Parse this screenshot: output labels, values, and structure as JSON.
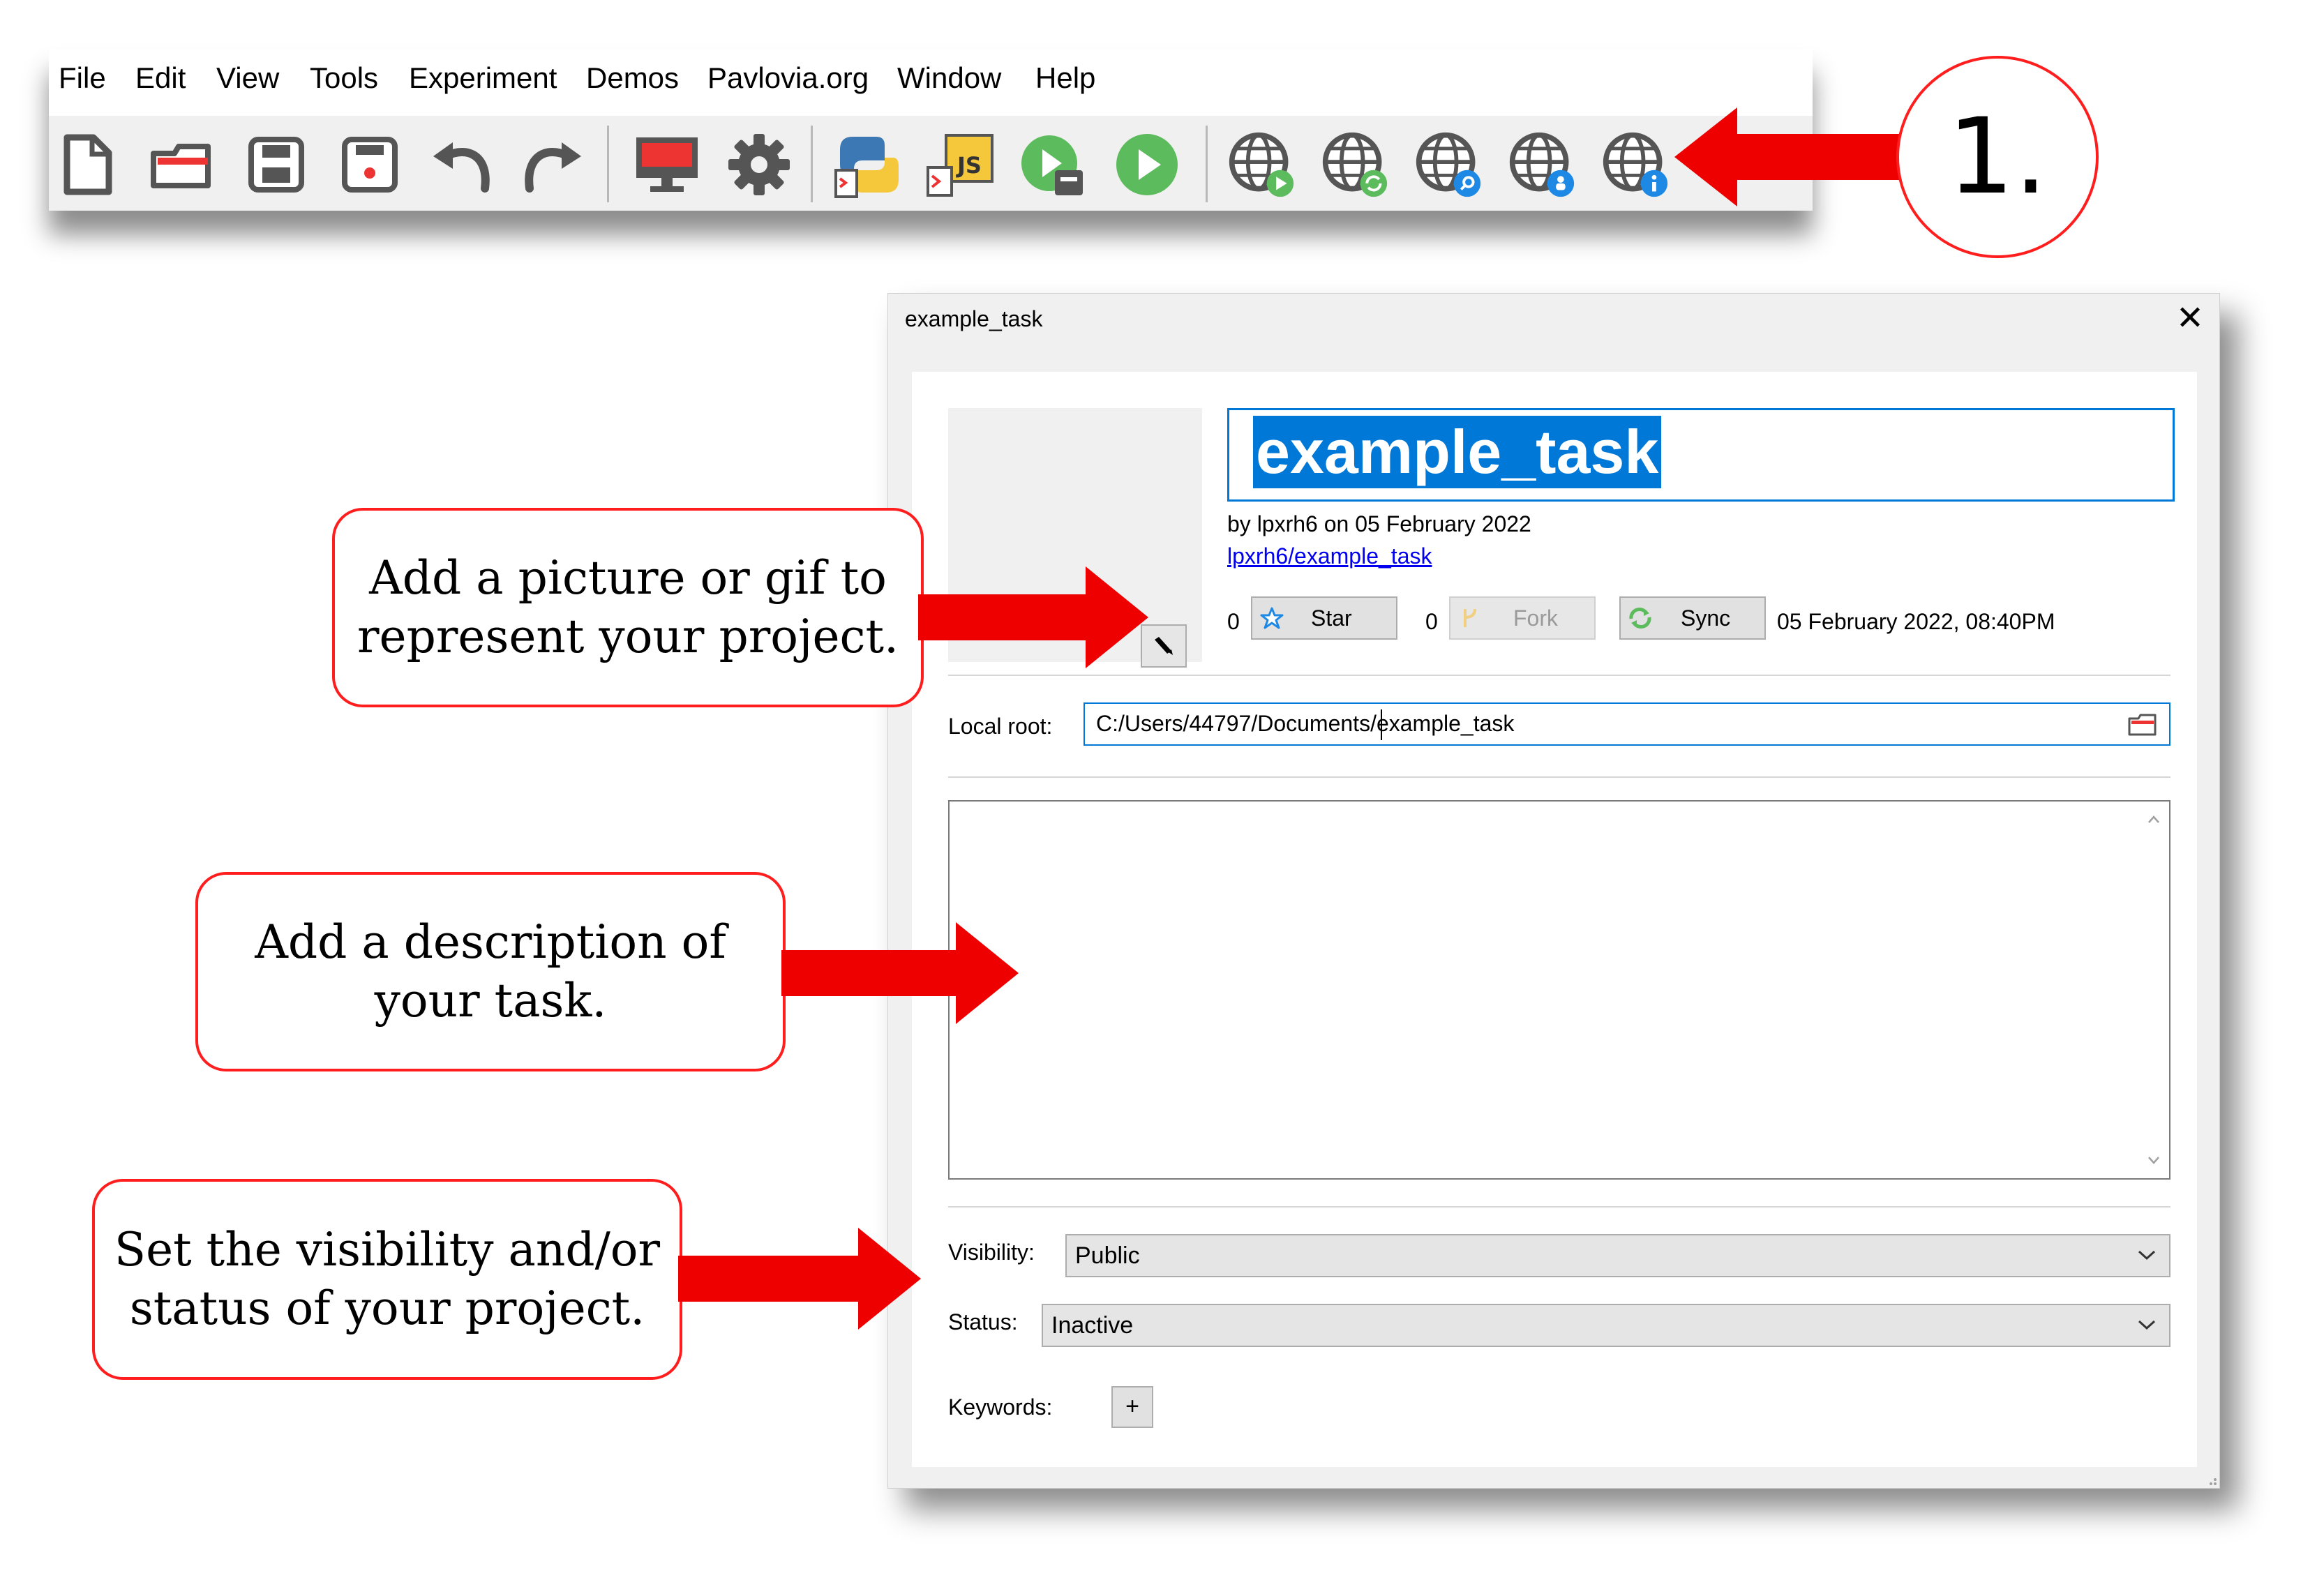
{
  "menubar": {
    "items": [
      "File",
      "Edit",
      "View",
      "Tools",
      "Experiment",
      "Demos",
      "Pavlovia.org",
      "Window",
      "Help"
    ]
  },
  "toolbar": {
    "icons": [
      "new-file-icon",
      "open-folder-icon",
      "save-icon",
      "save-as-icon",
      "undo-icon",
      "redo-icon",
      "monitor-icon",
      "gear-icon",
      "python-coder-icon",
      "js-coder-icon",
      "run-builder-icon",
      "run-icon",
      "pavlovia-run-icon",
      "pavlovia-sync-icon",
      "pavlovia-search-icon",
      "pavlovia-user-icon",
      "pavlovia-project-info-icon"
    ]
  },
  "callout_number": "1.",
  "dialog": {
    "window_title": "example_task",
    "close_symbol": "✕",
    "project_title": "example_task",
    "byline": "by lpxrh6 on 05 February 2022",
    "project_link": "lpxrh6/example_task",
    "star_count": "0",
    "star_label": "Star",
    "fork_count": "0",
    "fork_label": "Fork",
    "sync_label": "Sync",
    "timestamp": "05 February 2022, 08:40PM",
    "local_root_label": "Local root:",
    "local_root_value": "C:/Users/44797/Documents/example_task",
    "visibility_label": "Visibility:",
    "visibility_value": "Public",
    "status_label": "Status:",
    "status_value": "Inactive",
    "keywords_label": "Keywords:",
    "keywords_add": "+"
  },
  "annotations": {
    "picture": "Add a picture or gif to represent your project.",
    "description": "Add a description of your task.",
    "visibility": "Set the visibility and/or status of your project."
  },
  "colors": {
    "accent": "#0078d7",
    "callout_red": "#ff1d1d",
    "arrow_red": "#ee0000"
  }
}
